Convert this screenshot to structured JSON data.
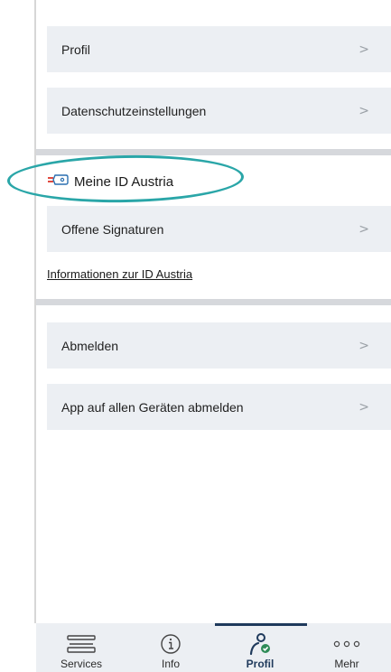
{
  "menu_top": [
    {
      "label": "Profil",
      "chevron": ">"
    },
    {
      "label": "Datenschutzeinstellungen",
      "chevron": ">"
    }
  ],
  "id_austria": {
    "title": "Meine ID Austria",
    "icon": "id-austria-logo-icon",
    "items": [
      {
        "label": "Offene Signaturen",
        "chevron": ">"
      }
    ],
    "info_link": "Informationen zur ID Austria"
  },
  "menu_bottom": [
    {
      "label": "Abmelden",
      "chevron": ">"
    },
    {
      "label": "App auf allen Geräten abmelden",
      "chevron": ">"
    }
  ],
  "bottom_nav": [
    {
      "label": "Services",
      "icon": "services-stack-icon",
      "active": false
    },
    {
      "label": "Info",
      "icon": "info-circle-icon",
      "active": false
    },
    {
      "label": "Profil",
      "icon": "profile-verified-icon",
      "active": true
    },
    {
      "label": "Mehr",
      "icon": "more-dots-icon",
      "active": false
    }
  ],
  "colors": {
    "item_bg": "#eceff3",
    "divider": "#d6d8dc",
    "highlight": "#2aa6a8",
    "active": "#1f3a5c",
    "id_austria_red": "#e04a3f"
  }
}
